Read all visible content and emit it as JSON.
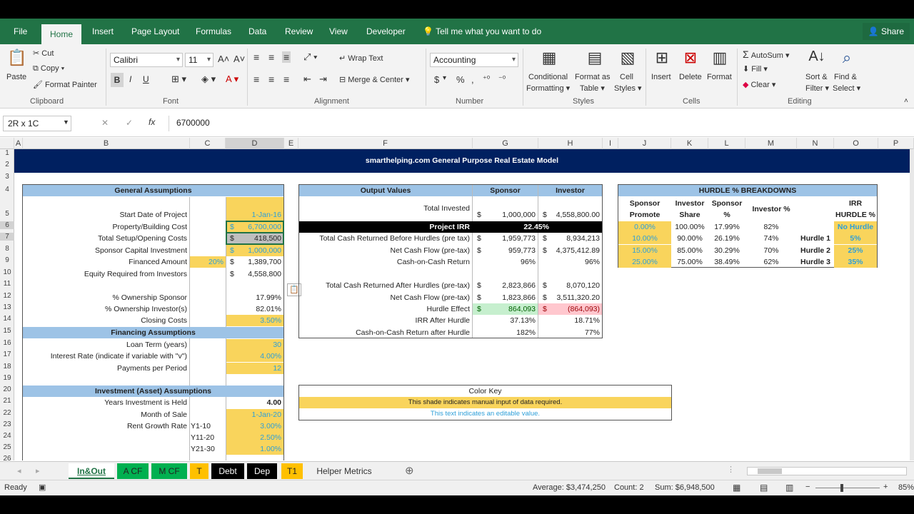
{
  "ribbon_tabs": [
    "File",
    "Home",
    "Insert",
    "Page Layout",
    "Formulas",
    "Data",
    "Review",
    "View",
    "Developer"
  ],
  "tell_me": "Tell me what you want to do",
  "share_label": "Share",
  "clipboard": {
    "paste": "Paste",
    "cut": "Cut",
    "copy": "Copy",
    "format_painter": "Format Painter",
    "group": "Clipboard"
  },
  "font": {
    "name": "Calibri",
    "size": "11",
    "group": "Font",
    "bold": "B",
    "italic": "I",
    "underline": "U"
  },
  "alignment": {
    "wrap": "Wrap Text",
    "merge": "Merge & Center",
    "group": "Alignment"
  },
  "number": {
    "format": "Accounting",
    "group": "Number",
    "dollar": "$",
    "percent": "%",
    "comma": ","
  },
  "styles": {
    "conditional": "Conditional",
    "conditional2": "Formatting",
    "format_as": "Format as",
    "format_as2": "Table",
    "cell": "Cell",
    "cell2": "Styles",
    "group": "Styles"
  },
  "cells": {
    "insert": "Insert",
    "delete": "Delete",
    "format": "Format",
    "group": "Cells"
  },
  "editing": {
    "autosum": "AutoSum",
    "fill": "Fill",
    "clear": "Clear",
    "sort": "Sort &",
    "sort2": "Filter",
    "find": "Find &",
    "find2": "Select",
    "group": "Editing"
  },
  "formula_bar": {
    "name_box": "2R x 1C",
    "value": "6700000"
  },
  "columns": [
    "A",
    "B",
    "C",
    "D",
    "E",
    "F",
    "G",
    "H",
    "I",
    "J",
    "K",
    "L",
    "M",
    "N",
    "O",
    "P"
  ],
  "rows": [
    "1",
    "2",
    "3",
    "4",
    "5",
    "6",
    "7",
    "8",
    "9",
    "10",
    "11",
    "12",
    "13",
    "14",
    "15",
    "16",
    "17",
    "18",
    "19",
    "20",
    "21",
    "22",
    "23",
    "24",
    "25",
    "26"
  ],
  "banner": "smarthelping.com General Purpose Real Estate Model",
  "general": {
    "title": "General Assumptions",
    "rows": [
      {
        "label": "Start Date of Project",
        "cur": "",
        "val": "1-Jan-16"
      },
      {
        "label": "Property/Building Cost",
        "cur": "$",
        "val": "6,700,000"
      },
      {
        "label": "Total Setup/Opening Costs",
        "cur": "$",
        "val": "418,500"
      },
      {
        "label": "Sponsor Capital Investment",
        "cur": "$",
        "val": "1,000,000"
      },
      {
        "label": "Financed Amount",
        "cur": "$",
        "val": "1,389,700",
        "pct": "20%"
      },
      {
        "label": "Equity Required from Investors",
        "cur": "$",
        "val": "4,558,800"
      },
      {
        "label": "% Ownership Sponsor",
        "cur": "",
        "val": "17.99%"
      },
      {
        "label": "% Ownership Investor(s)",
        "cur": "",
        "val": "82.01%"
      },
      {
        "label": "Closing Costs",
        "cur": "",
        "val": "3.50%"
      }
    ]
  },
  "financing": {
    "title": "Financing Assumptions",
    "rows": [
      {
        "label": "Loan Term (years)",
        "val": "30"
      },
      {
        "label": "Interest Rate (indicate if variable with \"v\")",
        "val": "4.00%"
      },
      {
        "label": "Payments per Period",
        "val": "12"
      }
    ]
  },
  "investment": {
    "title": "Investment (Asset) Assumptions",
    "rows": [
      {
        "label": "Years Investment is Held",
        "sub": "",
        "val": "4.00"
      },
      {
        "label": "Month of Sale",
        "sub": "",
        "val": "1-Jan-20"
      },
      {
        "label": "Rent Growth Rate",
        "sub": "Y1-10",
        "val": "3.00%"
      },
      {
        "label": "",
        "sub": "Y11-20",
        "val": "2.50%"
      },
      {
        "label": "",
        "sub": "Y21-30",
        "val": "1.00%"
      }
    ]
  },
  "output": {
    "title": "Output Values",
    "sponsor": "Sponsor",
    "investor": "Investor",
    "total_invested": {
      "label": "Total Invested",
      "s": "1,000,000",
      "i": "4,558,800.00"
    },
    "irr": {
      "label": "Project IRR",
      "val": "22.45%"
    },
    "rows1": [
      {
        "label": "Total Cash Returned Before Hurdles (pre tax)",
        "sc": "$",
        "s": "1,959,773",
        "ic": "$",
        "i": "8,934,213"
      },
      {
        "label": "Net Cash Flow (pre-tax)",
        "sc": "$",
        "s": "959,773",
        "ic": "$",
        "i": "4,375,412.89"
      },
      {
        "label": "Cash-on-Cash Return",
        "sc": "",
        "s": "96%",
        "ic": "",
        "i": "96%"
      }
    ],
    "rows2": [
      {
        "label": "Total Cash Returned After Hurdles (pre-tax)",
        "sc": "$",
        "s": "2,823,866",
        "ic": "$",
        "i": "8,070,120"
      },
      {
        "label": "Net Cash Flow (pre-tax)",
        "sc": "$",
        "s": "1,823,866",
        "ic": "$",
        "i": "3,511,320.20"
      },
      {
        "label": "Hurdle Effect",
        "sc": "$",
        "s": "864,093",
        "ic": "$",
        "i": "(864,093)"
      },
      {
        "label": "IRR After Hurdle",
        "sc": "",
        "s": "37.13%",
        "ic": "",
        "i": "18.71%"
      },
      {
        "label": "Cash-on-Cash Return after Hurdle",
        "sc": "",
        "s": "182%",
        "ic": "",
        "i": "77%"
      }
    ]
  },
  "hurdle": {
    "title": "HURDLE % BREAKDOWNS",
    "h_promote1": "Sponsor",
    "h_promote2": "Promote",
    "h_share1": "Investor",
    "h_share2": "Share",
    "h_sp1": "Sponsor",
    "h_sp2": "%",
    "h_inv": "Investor %",
    "h_irr1": "IRR",
    "h_irr2": "HURDLE %",
    "rows": [
      {
        "promote": "0.00%",
        "share": "100.00%",
        "sp": "17.99%",
        "inv": "82%",
        "name": "",
        "irr": "No Hurdle"
      },
      {
        "promote": "10.00%",
        "share": "90.00%",
        "sp": "26.19%",
        "inv": "74%",
        "name": "Hurdle 1",
        "irr": "5%"
      },
      {
        "promote": "15.00%",
        "share": "85.00%",
        "sp": "30.29%",
        "inv": "70%",
        "name": "Hurdle 2",
        "irr": "25%"
      },
      {
        "promote": "25.00%",
        "share": "75.00%",
        "sp": "38.49%",
        "inv": "62%",
        "name": "Hurdle 3",
        "irr": "35%"
      }
    ]
  },
  "color_key": {
    "title": "Color Key",
    "shade": "This shade indicates manual input of data required.",
    "text": "This text indicates an editable value."
  },
  "sheet_tabs": [
    {
      "label": "In&Out",
      "bg": "#ffffff",
      "fg": "#217346"
    },
    {
      "label": "A CF",
      "bg": "#00b050",
      "fg": "#000000"
    },
    {
      "label": "M CF",
      "bg": "#00b050",
      "fg": "#000000"
    },
    {
      "label": "T",
      "bg": "#ffc000",
      "fg": "#000000"
    },
    {
      "label": "Debt",
      "bg": "#000000",
      "fg": "#ffffff"
    },
    {
      "label": "Dep",
      "bg": "#000000",
      "fg": "#ffffff"
    },
    {
      "label": "T1",
      "bg": "#ffc000",
      "fg": "#000000"
    },
    {
      "label": "Helper Metrics",
      "bg": "#f0f0f0",
      "fg": "#333333"
    }
  ],
  "status": {
    "ready": "Ready",
    "average": "Average: $3,474,250",
    "count": "Count: 2",
    "sum": "Sum: $6,948,500",
    "zoom": "85%"
  },
  "colors": {
    "excel_green": "#217346",
    "banner": "#002060",
    "header_blue": "#9dc3e6",
    "input_yellow": "#f9d45c",
    "editable_text": "#2e9fd8"
  }
}
